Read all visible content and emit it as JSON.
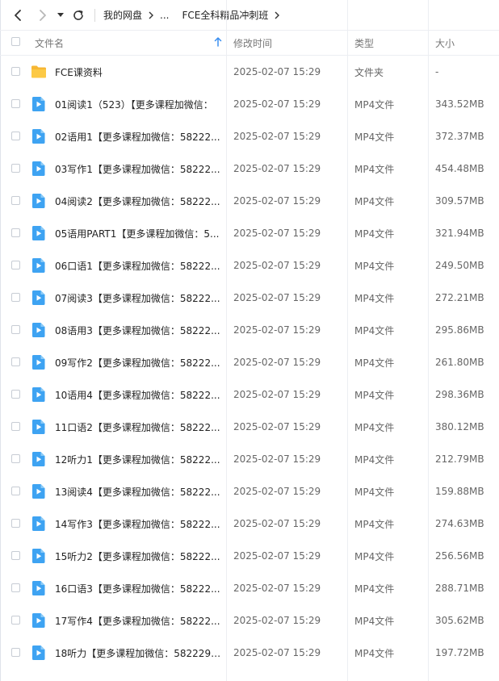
{
  "breadcrumb": {
    "root": "我的网盘",
    "ellipsis": "...",
    "current": "FCE全科精品冲刺班"
  },
  "columns": {
    "name": "文件名",
    "modified": "修改时间",
    "type": "类型",
    "size": "大小"
  },
  "icons": {
    "back": "chevron-left-icon",
    "forward": "chevron-right-icon",
    "history": "caret-down-icon",
    "refresh": "refresh-icon",
    "sort": "sort-arrow-up-icon",
    "folder": "folder-icon",
    "video": "video-play-icon"
  },
  "colors": {
    "folder": "#f7b733",
    "video": "#3ea3f2",
    "sort_arrow": "#3b8ff0"
  },
  "files": [
    {
      "name": "FCE课资料",
      "modified": "2025-02-07 15:29",
      "type": "文件夹",
      "size": "-",
      "kind": "folder"
    },
    {
      "name": "01阅读1（523）【更多课程加微信：",
      "modified": "2025-02-07 15:29",
      "type": "MP4文件",
      "size": "343.52MB",
      "kind": "video"
    },
    {
      "name": "02语用1【更多课程加微信：58222...",
      "modified": "2025-02-07 15:29",
      "type": "MP4文件",
      "size": "372.37MB",
      "kind": "video"
    },
    {
      "name": "03写作1【更多课程加微信：58222...",
      "modified": "2025-02-07 15:29",
      "type": "MP4文件",
      "size": "454.48MB",
      "kind": "video"
    },
    {
      "name": "04阅读2【更多课程加微信：58222...",
      "modified": "2025-02-07 15:29",
      "type": "MP4文件",
      "size": "309.57MB",
      "kind": "video"
    },
    {
      "name": "05语用PART1【更多课程加微信：5...",
      "modified": "2025-02-07 15:29",
      "type": "MP4文件",
      "size": "321.94MB",
      "kind": "video"
    },
    {
      "name": "06口语1【更多课程加微信：58222...",
      "modified": "2025-02-07 15:29",
      "type": "MP4文件",
      "size": "249.50MB",
      "kind": "video"
    },
    {
      "name": "07阅读3【更多课程加微信：58222...",
      "modified": "2025-02-07 15:29",
      "type": "MP4文件",
      "size": "272.21MB",
      "kind": "video"
    },
    {
      "name": "08语用3【更多课程加微信：58222...",
      "modified": "2025-02-07 15:29",
      "type": "MP4文件",
      "size": "295.86MB",
      "kind": "video"
    },
    {
      "name": "09写作2【更多课程加微信：58222...",
      "modified": "2025-02-07 15:29",
      "type": "MP4文件",
      "size": "261.80MB",
      "kind": "video"
    },
    {
      "name": "10语用4【更多课程加微信：58222...",
      "modified": "2025-02-07 15:29",
      "type": "MP4文件",
      "size": "298.36MB",
      "kind": "video"
    },
    {
      "name": "11口语2【更多课程加微信：58222...",
      "modified": "2025-02-07 15:29",
      "type": "MP4文件",
      "size": "380.12MB",
      "kind": "video"
    },
    {
      "name": "12听力1【更多课程加微信：58222...",
      "modified": "2025-02-07 15:29",
      "type": "MP4文件",
      "size": "212.79MB",
      "kind": "video"
    },
    {
      "name": "13阅读4【更多课程加微信：58222...",
      "modified": "2025-02-07 15:29",
      "type": "MP4文件",
      "size": "159.88MB",
      "kind": "video"
    },
    {
      "name": "14写作3【更多课程加微信：58222...",
      "modified": "2025-02-07 15:29",
      "type": "MP4文件",
      "size": "274.63MB",
      "kind": "video"
    },
    {
      "name": "15听力2【更多课程加微信：58222...",
      "modified": "2025-02-07 15:29",
      "type": "MP4文件",
      "size": "256.56MB",
      "kind": "video"
    },
    {
      "name": "16口语3【更多课程加微信：58222...",
      "modified": "2025-02-07 15:29",
      "type": "MP4文件",
      "size": "288.71MB",
      "kind": "video"
    },
    {
      "name": "17写作4【更多课程加微信：58222...",
      "modified": "2025-02-07 15:29",
      "type": "MP4文件",
      "size": "305.62MB",
      "kind": "video"
    },
    {
      "name": "18听力【更多课程加微信：582229 ...",
      "modified": "2025-02-07 15:29",
      "type": "MP4文件",
      "size": "197.72MB",
      "kind": "video"
    }
  ]
}
